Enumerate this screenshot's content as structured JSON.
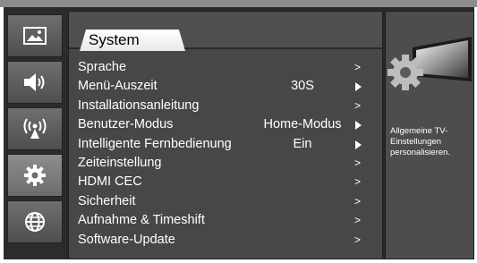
{
  "sidebar": {
    "items": [
      {
        "name": "picture",
        "icon": "picture-icon"
      },
      {
        "name": "sound",
        "icon": "speaker-icon"
      },
      {
        "name": "channel",
        "icon": "antenna-icon"
      },
      {
        "name": "system",
        "icon": "gear-icon",
        "active": true
      },
      {
        "name": "network",
        "icon": "globe-icon"
      }
    ]
  },
  "main": {
    "tab_label": "System",
    "menu": [
      {
        "label": "Sprache",
        "value": "",
        "indicator": ">"
      },
      {
        "label": "Menü-Auszeit",
        "value": "30S",
        "indicator": "triangle"
      },
      {
        "label": "Installationsanleitung",
        "value": "",
        "indicator": ">"
      },
      {
        "label": "Benutzer-Modus",
        "value": "Home-Modus",
        "indicator": "triangle"
      },
      {
        "label": "Intelligente Fernbedienung",
        "value": "Ein",
        "indicator": "triangle"
      },
      {
        "label": "Zeiteinstellung",
        "value": "",
        "indicator": ">"
      },
      {
        "label": "HDMI CEC",
        "value": "",
        "indicator": ">"
      },
      {
        "label": "Sicherheit",
        "value": "",
        "indicator": ">"
      },
      {
        "label": "Aufnahme & Timeshift",
        "value": "",
        "indicator": ">"
      },
      {
        "label": "Software-Update",
        "value": "",
        "indicator": ">"
      }
    ]
  },
  "info": {
    "icon": "settings-gear-tv-icon",
    "description": "Allgemeine TV-Einstellungen personalisieren."
  },
  "colors": {
    "panel": "#474747",
    "sidebar_item": "#6f6f6f",
    "text": "#ffffff",
    "tab": "#ffffff"
  }
}
